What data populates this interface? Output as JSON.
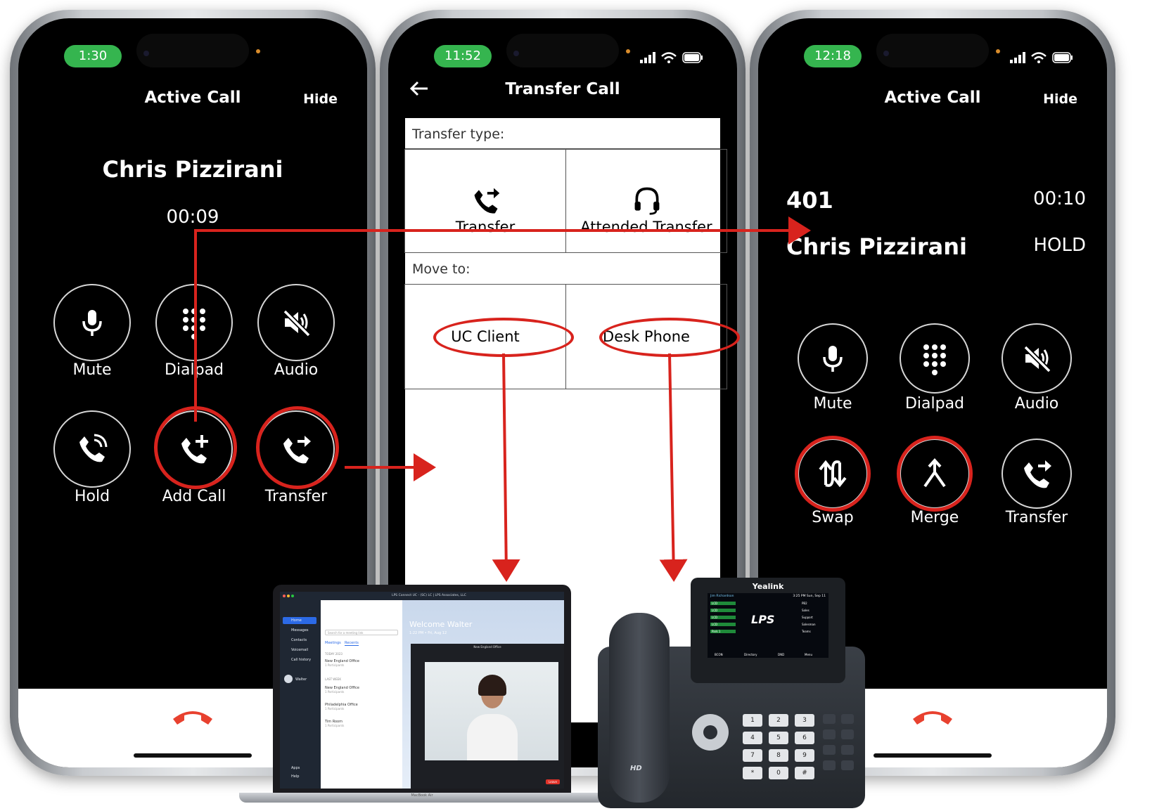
{
  "phone1": {
    "clock": "1:30",
    "title": "Active Call",
    "hide": "Hide",
    "caller": "Chris Pizzirani",
    "timer": "00:09",
    "buttons": [
      "Mute",
      "Dialpad",
      "Audio",
      "Hold",
      "Add Call",
      "Transfer"
    ]
  },
  "phone2": {
    "clock": "11:52",
    "title": "Transfer Call",
    "transfer_type_label": "Transfer type:",
    "transfer_label": "Transfer",
    "attended_label": "Attended Transfer",
    "move_to_label": "Move to:",
    "uc_client_label": "UC Client",
    "desk_phone_label": "Desk Phone"
  },
  "phone3": {
    "clock": "12:18",
    "title": "Active Call",
    "hide": "Hide",
    "line1_number": "401",
    "line1_timer": "00:10",
    "line2_caller": "Chris Pizzirani",
    "line2_status": "HOLD",
    "buttons": [
      "Mute",
      "Dialpad",
      "Audio",
      "Swap",
      "Merge",
      "Transfer"
    ]
  },
  "laptop": {
    "window_title": "LPS Connect UC - (SC) LC | LPS Associates, LLC",
    "sidebar": [
      "Home",
      "Messages",
      "Contacts",
      "Voicemail",
      "Call history"
    ],
    "user": "Walter",
    "sidebar_bottom": [
      "Apps",
      "Help"
    ],
    "search_placeholder": "Search for a meeting link",
    "tabs": [
      "Meetings",
      "Recents"
    ],
    "recent_heading": "TODAY 2023",
    "meetings": [
      {
        "name": "New England Office",
        "sub": "1 Participants"
      },
      {
        "name": "New England Office",
        "sub": "1 Participants"
      },
      {
        "name": "Philadelphia Office",
        "sub": "1 Participants"
      },
      {
        "name": "Tim Room",
        "sub": "1 Participants"
      }
    ],
    "last_week_heading": "LAST WEEK",
    "welcome": "Welcome Walter",
    "date": "1:22 PM • Fri, Aug 12",
    "video_title": "New England Office",
    "leave": "Leave",
    "model": "MacBook Air"
  },
  "deskphone": {
    "brand": "Yealink",
    "logo": "LPS",
    "hd": "HD",
    "screen_name": "Jim Richardson",
    "screen_time": "3:25 PM Sun, Sep 11",
    "left_lines": [
      "LCD",
      "LCD",
      "LCD",
      "LCD",
      "Park 1"
    ],
    "right_lines": [
      "PB2",
      "Sales",
      "Support",
      "Salesman",
      "Teams"
    ],
    "softkeys": [
      "BCON",
      "Directory",
      "DND",
      "Menu"
    ],
    "keypad": [
      "1",
      "2",
      "3",
      "4",
      "5",
      "6",
      "7",
      "8",
      "9",
      "*",
      "0",
      "#"
    ]
  },
  "colors": {
    "accent_red": "#d8231d",
    "clock_green": "#35b54f",
    "hangup_red": "#e8412f"
  }
}
